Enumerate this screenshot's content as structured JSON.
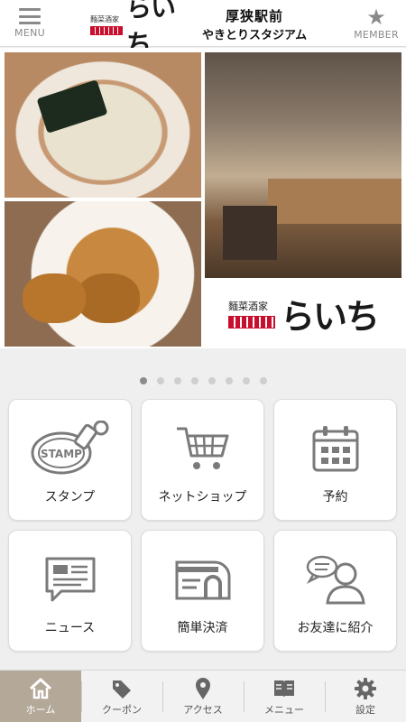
{
  "header": {
    "menu_label": "MENU",
    "member_label": "MEMBER",
    "brand_tag": "麵菜酒家",
    "brand_name": "らいち",
    "location_line1": "厚狭駅前",
    "location_line2": "やきとりスタジアム"
  },
  "banner": {
    "logo_tag": "麵菜酒家",
    "logo_name": "らいち",
    "slide_count": 8,
    "active_slide": 1
  },
  "tiles": [
    {
      "label": "スタンプ",
      "icon": "stamp-icon",
      "stamp_text": "STAMP"
    },
    {
      "label": "ネットショップ",
      "icon": "shopping-cart-icon"
    },
    {
      "label": "予約",
      "icon": "calendar-icon"
    },
    {
      "label": "ニュース",
      "icon": "news-icon"
    },
    {
      "label": "簡単決済",
      "icon": "payment-card-icon"
    },
    {
      "label": "お友達に紹介",
      "icon": "refer-friend-icon"
    }
  ],
  "tabs": [
    {
      "label": "ホーム",
      "icon": "home-icon",
      "active": true
    },
    {
      "label": "クーポン",
      "icon": "coupon-tag-icon"
    },
    {
      "label": "アクセス",
      "icon": "location-pin-icon"
    },
    {
      "label": "メニュー",
      "icon": "menu-book-icon"
    },
    {
      "label": "設定",
      "icon": "gear-icon"
    }
  ],
  "colors": {
    "header_bg": "#ffffff",
    "icon_gray": "#8a8a8a",
    "tile_icon": "#7a7a7a",
    "accent_red": "#c8102e",
    "active_tab_bg": "#b4a899",
    "page_bg": "#efefef"
  }
}
